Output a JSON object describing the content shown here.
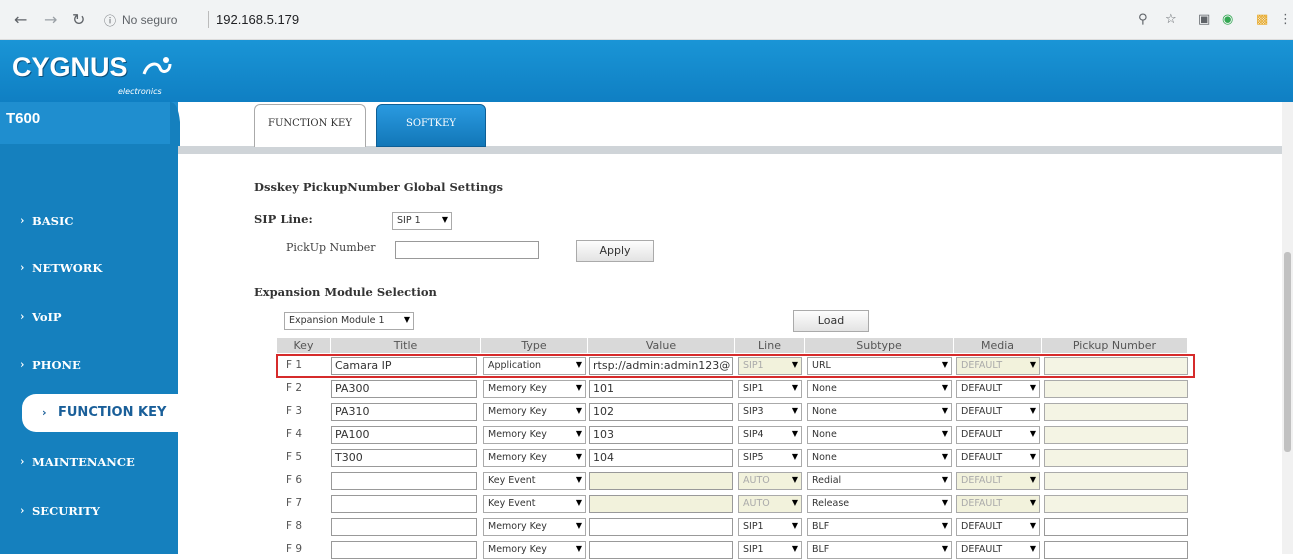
{
  "browser": {
    "security_label": "No seguro",
    "url": "192.168.5.179"
  },
  "brand": {
    "logo": "CYGNUS",
    "sub": "electronics"
  },
  "sidebar": {
    "model": "T600",
    "items": [
      {
        "label": "BASIC"
      },
      {
        "label": "NETWORK"
      },
      {
        "label": "VoIP"
      },
      {
        "label": "PHONE"
      },
      {
        "label": "FUNCTION KEY",
        "active": true
      },
      {
        "label": "MAINTENANCE"
      },
      {
        "label": "SECURITY"
      }
    ]
  },
  "tabs": {
    "function_key": "FUNCTION KEY",
    "softkey": "SOFTKEY"
  },
  "pickup": {
    "heading": "Dsskey PickupNumber Global Settings",
    "sip_line_label": "SIP Line:",
    "sip_line_value": "SIP 1",
    "pickup_number_label": "PickUp Number",
    "pickup_number_value": "",
    "apply_label": "Apply"
  },
  "expansion": {
    "heading": "Expansion Module Selection",
    "module_value": "Expansion Module 1",
    "load_label": "Load"
  },
  "table": {
    "columns": [
      "Key",
      "Title",
      "Type",
      "Value",
      "Line",
      "Subtype",
      "Media",
      "Pickup Number"
    ],
    "rows": [
      {
        "key": "F 1",
        "title": "Camara IP",
        "type": "Application",
        "value": "rtsp://admin:admin123@",
        "line": "SIP1",
        "subtype": "URL",
        "media": "DEFAULT",
        "pickup": "",
        "line_disabled": true,
        "media_disabled": true,
        "value_disabled": false
      },
      {
        "key": "F 2",
        "title": "PA300",
        "type": "Memory Key",
        "value": "101",
        "line": "SIP1",
        "subtype": "None",
        "media": "DEFAULT",
        "pickup": "",
        "line_disabled": false,
        "media_disabled": false,
        "value_disabled": false
      },
      {
        "key": "F 3",
        "title": "PA310",
        "type": "Memory Key",
        "value": "102",
        "line": "SIP3",
        "subtype": "None",
        "media": "DEFAULT",
        "pickup": "",
        "line_disabled": false,
        "media_disabled": false,
        "value_disabled": false
      },
      {
        "key": "F 4",
        "title": "PA100",
        "type": "Memory Key",
        "value": "103",
        "line": "SIP4",
        "subtype": "None",
        "media": "DEFAULT",
        "pickup": "",
        "line_disabled": false,
        "media_disabled": false,
        "value_disabled": false
      },
      {
        "key": "F 5",
        "title": "T300",
        "type": "Memory Key",
        "value": "104",
        "line": "SIP5",
        "subtype": "None",
        "media": "DEFAULT",
        "pickup": "",
        "line_disabled": false,
        "media_disabled": false,
        "value_disabled": false
      },
      {
        "key": "F 6",
        "title": "",
        "type": "Key Event",
        "value": "",
        "line": "AUTO",
        "subtype": "Redial",
        "media": "DEFAULT",
        "pickup": "",
        "line_disabled": true,
        "media_disabled": true,
        "value_disabled": true
      },
      {
        "key": "F 7",
        "title": "",
        "type": "Key Event",
        "value": "",
        "line": "AUTO",
        "subtype": "Release",
        "media": "DEFAULT",
        "pickup": "",
        "line_disabled": true,
        "media_disabled": true,
        "value_disabled": true
      },
      {
        "key": "F 8",
        "title": "",
        "type": "Memory Key",
        "value": "",
        "line": "SIP1",
        "subtype": "BLF",
        "media": "DEFAULT",
        "pickup": "",
        "line_disabled": false,
        "media_disabled": false,
        "value_disabled": false
      },
      {
        "key": "F 9",
        "title": "",
        "type": "Memory Key",
        "value": "",
        "line": "SIP1",
        "subtype": "BLF",
        "media": "DEFAULT",
        "pickup": "",
        "line_disabled": false,
        "media_disabled": false,
        "value_disabled": false
      }
    ]
  }
}
